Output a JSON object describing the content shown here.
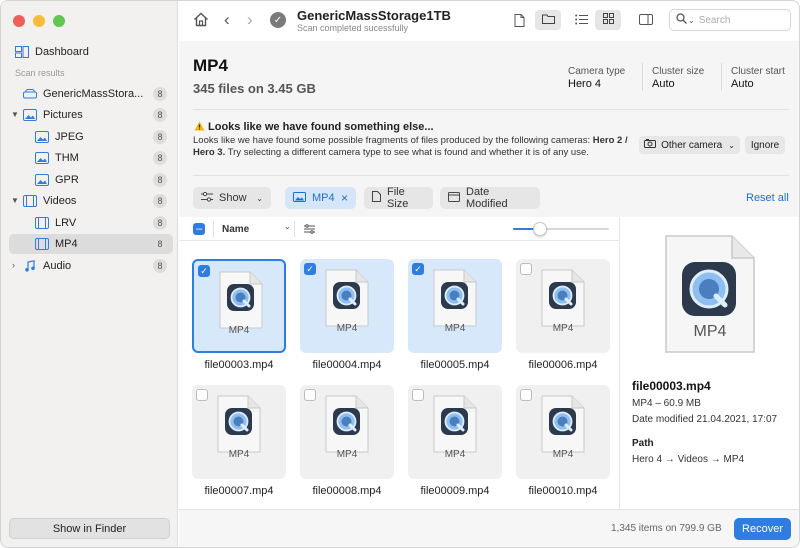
{
  "sidebar": {
    "dashboard": "Dashboard",
    "section_label": "Scan results",
    "items": [
      {
        "label": "GenericMassStora...",
        "count": "8"
      },
      {
        "label": "Pictures",
        "count": "8"
      },
      {
        "label": "JPEG",
        "count": "8"
      },
      {
        "label": "THM",
        "count": "8"
      },
      {
        "label": "GPR",
        "count": "8"
      },
      {
        "label": "Videos",
        "count": "8"
      },
      {
        "label": "LRV",
        "count": "8"
      },
      {
        "label": "MP4",
        "count": "8"
      },
      {
        "label": "Audio",
        "count": "8"
      }
    ],
    "show_in_finder": "Show in Finder"
  },
  "toolbar": {
    "title": "GenericMassStorage1TB",
    "subtitle": "Scan completed sucessfully",
    "search_placeholder": "Search"
  },
  "header": {
    "title": "MP4",
    "summary": "345 files on 3.45 GB",
    "meta": [
      {
        "label": "Camera type",
        "value": "Hero 4"
      },
      {
        "label": "Cluster size",
        "value": "Auto"
      },
      {
        "label": "Cluster start",
        "value": "Auto"
      }
    ]
  },
  "notice": {
    "title": "Looks like we have found something else...",
    "body_prefix": "Looks like we have found some possible fragments of files produced by the following cameras:",
    "cameras": "Hero 2 / Hero 3.",
    "body_suffix": "Try selecting a different camera type to see what is found and whether it is of any use.",
    "camera_button": "Other camera",
    "ignore_button": "Ignore"
  },
  "filters": {
    "show": "Show",
    "type": "MP4",
    "file_size": "File Size",
    "date_modified": "Date Modified",
    "reset": "Reset all"
  },
  "list_header": {
    "name": "Name"
  },
  "files": [
    {
      "name": "file00003.mp4",
      "checked": true,
      "badge": "MP4"
    },
    {
      "name": "file00004.mp4",
      "checked": true,
      "badge": "MP4"
    },
    {
      "name": "file00005.mp4",
      "checked": true,
      "badge": "MP4"
    },
    {
      "name": "file00006.mp4",
      "checked": false,
      "badge": "MP4"
    },
    {
      "name": "file00007.mp4",
      "checked": false,
      "badge": "MP4"
    },
    {
      "name": "file00008.mp4",
      "checked": false,
      "badge": "MP4"
    },
    {
      "name": "file00009.mp4",
      "checked": false,
      "badge": "MP4"
    },
    {
      "name": "file00010.mp4",
      "checked": false,
      "badge": "MP4"
    }
  ],
  "preview": {
    "badge": "MP4",
    "filename": "file00003.mp4",
    "type_size": "MP4 – 60.9 MB",
    "modified": "Date modified 21.04.2021, 17:07",
    "path_label": "Path",
    "path": "Hero 4 → Videos → MP4"
  },
  "footer": {
    "status": "1,345 items on 799.9 GB",
    "recover": "Recover"
  },
  "colors": {
    "accent": "#2f7de0",
    "selection": "#d8e8fb",
    "sidebar_bg": "#f2f1f0"
  }
}
